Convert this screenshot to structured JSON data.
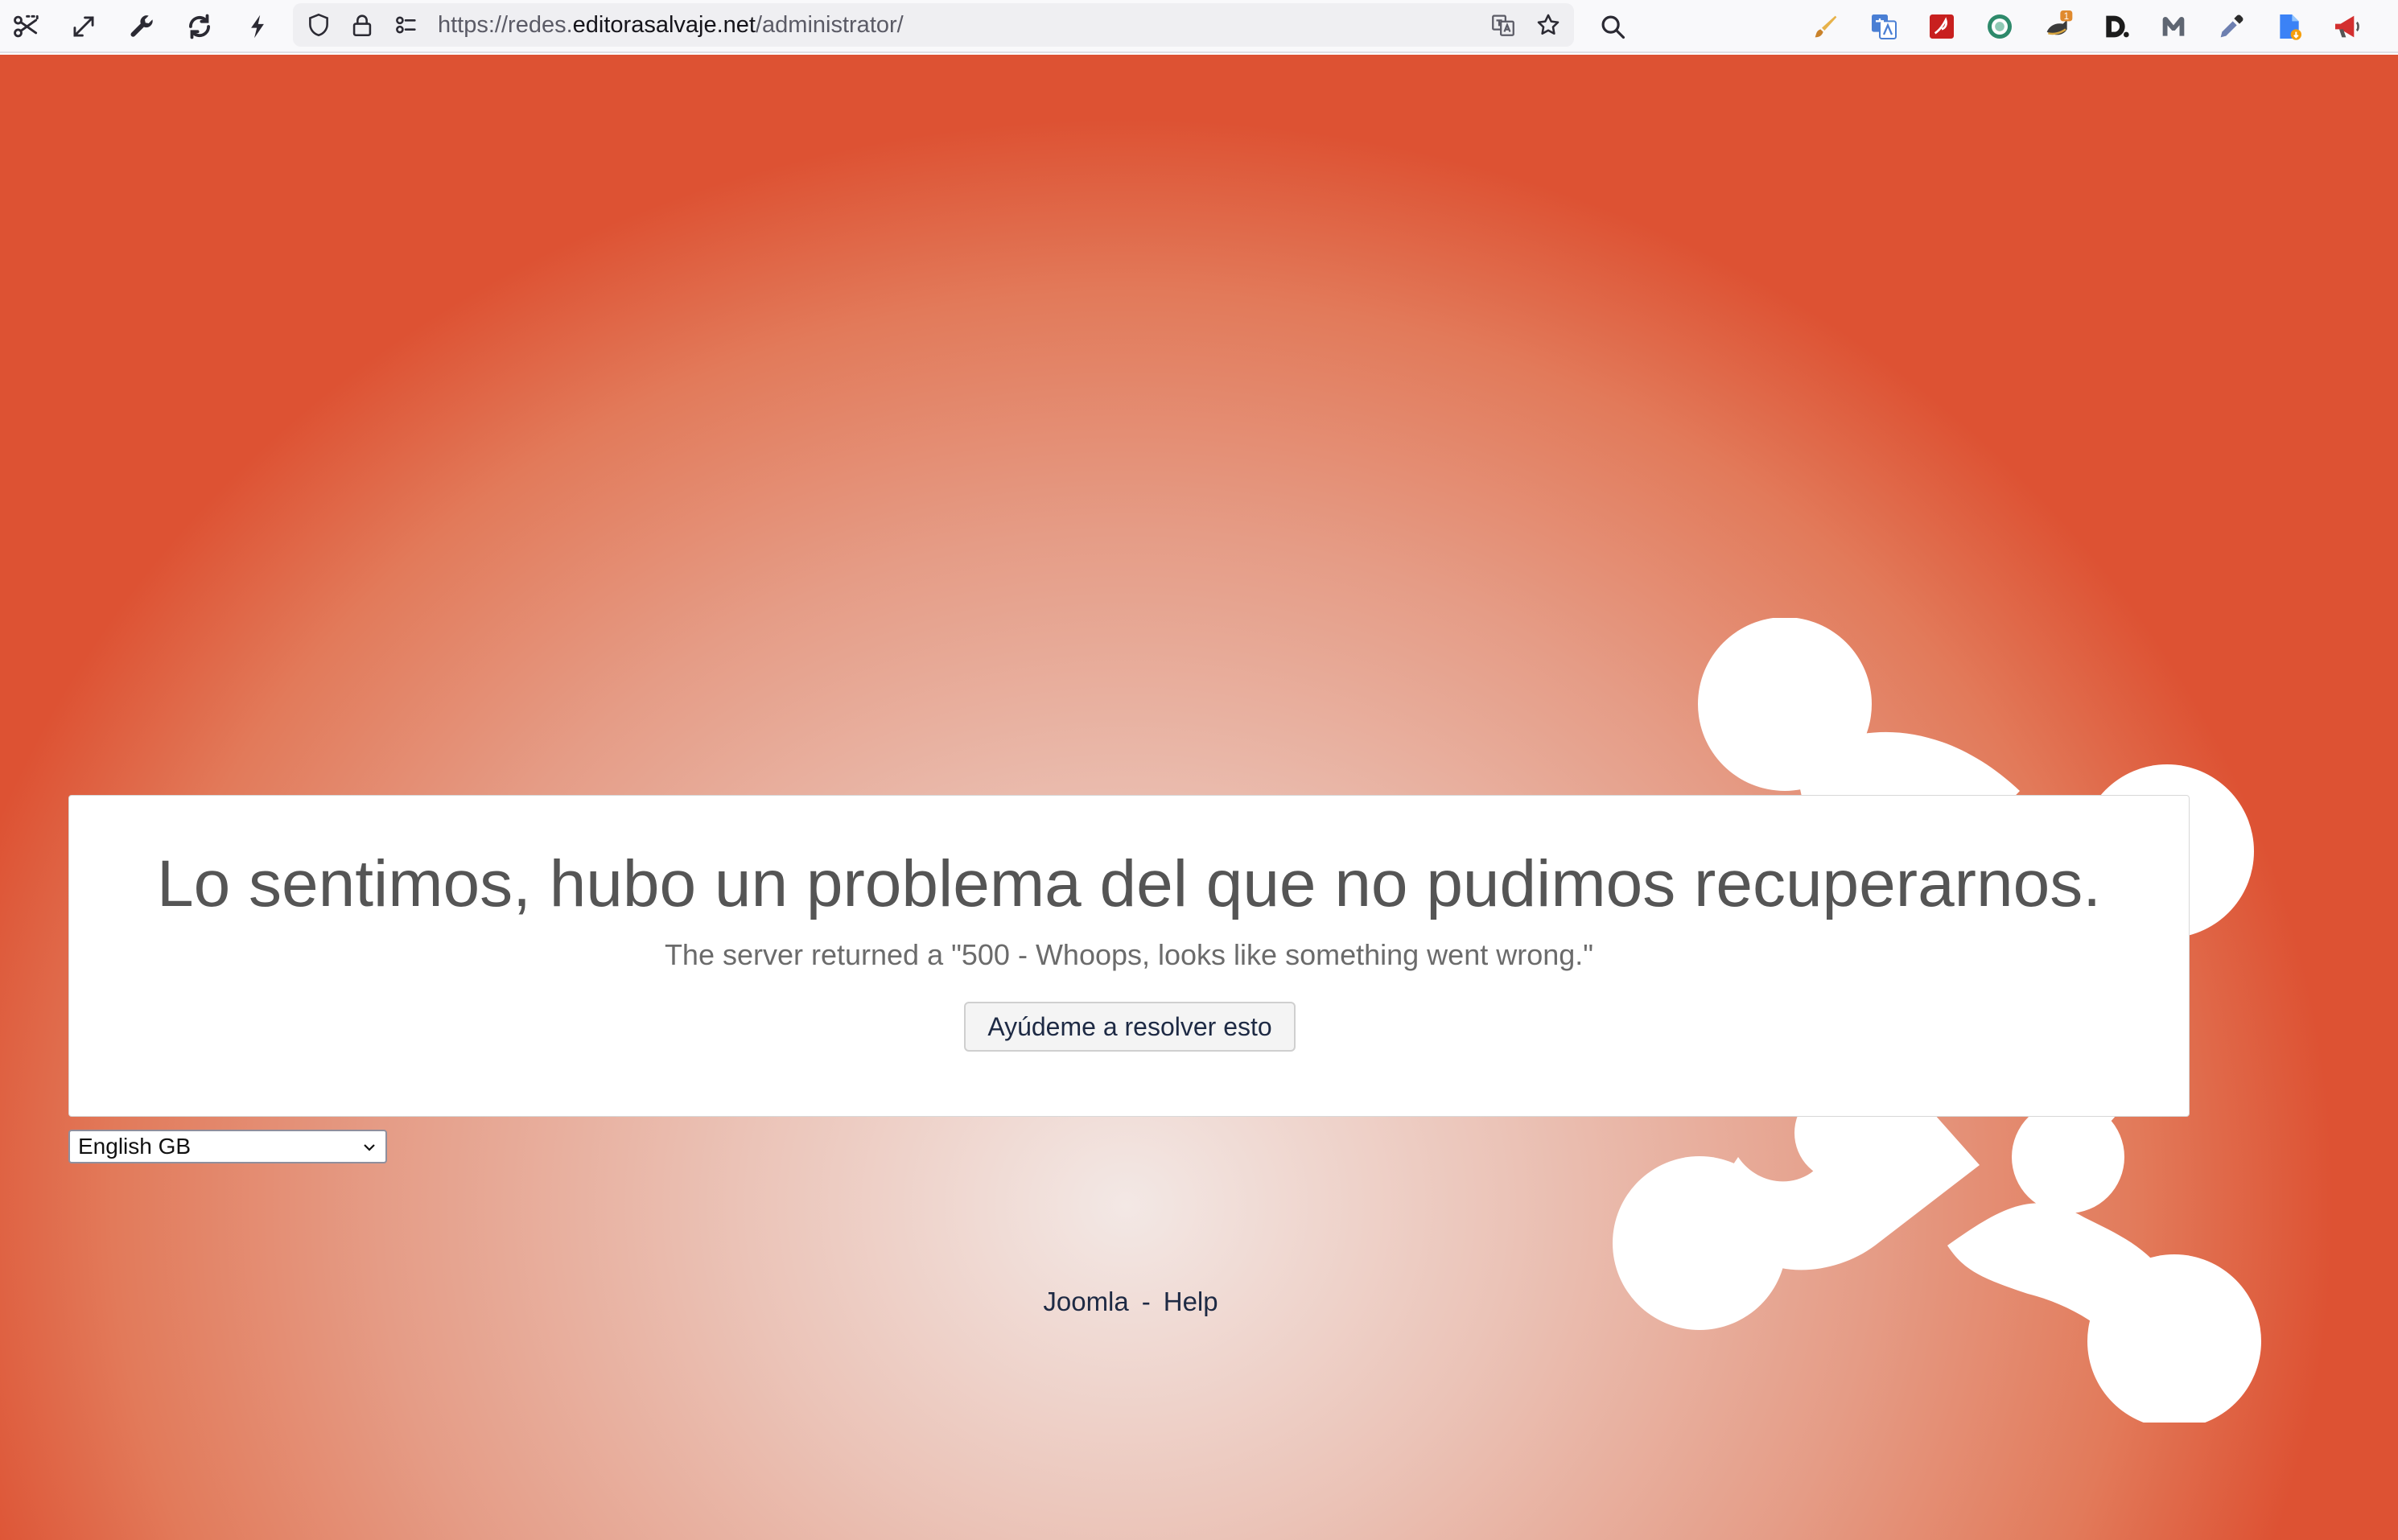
{
  "browser": {
    "url_prefix": "https://redes.",
    "url_host": "editorasalvaje.net",
    "url_path": "/administrator/",
    "extension_badge": "1",
    "icons": {
      "toolbar": [
        "screenshot-icon",
        "expand-icon",
        "wrench-icon",
        "reload-icon",
        "lightning-icon"
      ],
      "urlbar": [
        "shield-icon",
        "lock-icon",
        "permissions-icon",
        "translate-icon",
        "star-icon"
      ],
      "search": "search-icon",
      "extensions": [
        "brush-extension-icon",
        "translate-extension-icon",
        "pdf-extension-icon",
        "circle-extension-icon",
        "cat-extension-icon",
        "d-extension-icon",
        "malwarebytes-icon",
        "eyedropper-icon",
        "doc-download-icon",
        "megaphone-icon"
      ]
    }
  },
  "page": {
    "error_heading": "Lo sentimos, hubo un problema del que no pudimos recuperarnos.",
    "error_detail": "The server returned a \"500 - Whoops, looks like something went wrong.\"",
    "help_button": "Ayúdeme a resolver esto",
    "language_selected": "English GB",
    "footer": {
      "link1": "Joomla",
      "separator": "-",
      "link2": "Help"
    },
    "colors": {
      "background_edge": "#dd5233",
      "background_center": "#f3e8e5",
      "logo": "#ffffff"
    }
  }
}
